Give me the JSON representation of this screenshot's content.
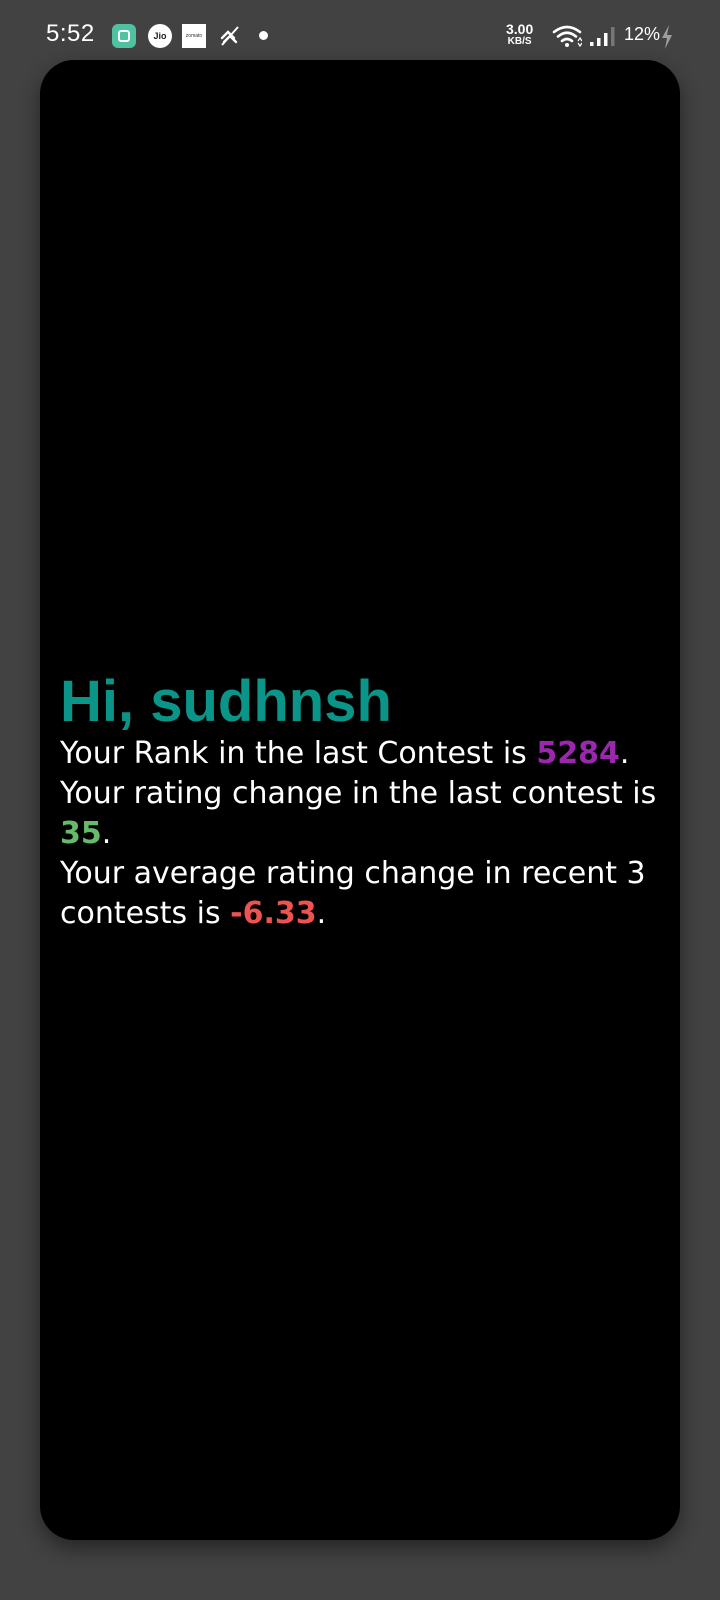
{
  "status_bar": {
    "time": "5:52",
    "apps": [
      "app-icon",
      "jio-icon",
      "zomato-icon",
      "muted-icon"
    ],
    "jio_label": "Jio",
    "zomato_label": "zomato",
    "speed_value": "3.00",
    "speed_unit": "KB/S",
    "battery_percent": "12%"
  },
  "main": {
    "greeting": "Hi, sudhnsh",
    "rank": {
      "prefix": "Your Rank in the last Contest is ",
      "value": "5284",
      "suffix": ".",
      "color": "#9b27af"
    },
    "rating_change": {
      "prefix": "Your rating change in the last contest is ",
      "value": "35",
      "suffix": ".",
      "color": "#66bb6a"
    },
    "avg_rating_change": {
      "prefix": "Your average rating change in recent 3 contests is ",
      "value": "-6.33",
      "suffix": ".",
      "color": "#ef5350"
    }
  },
  "colors": {
    "background": "#424242",
    "card": "#000000",
    "greeting": "#0b9488",
    "text": "#ffffff"
  }
}
